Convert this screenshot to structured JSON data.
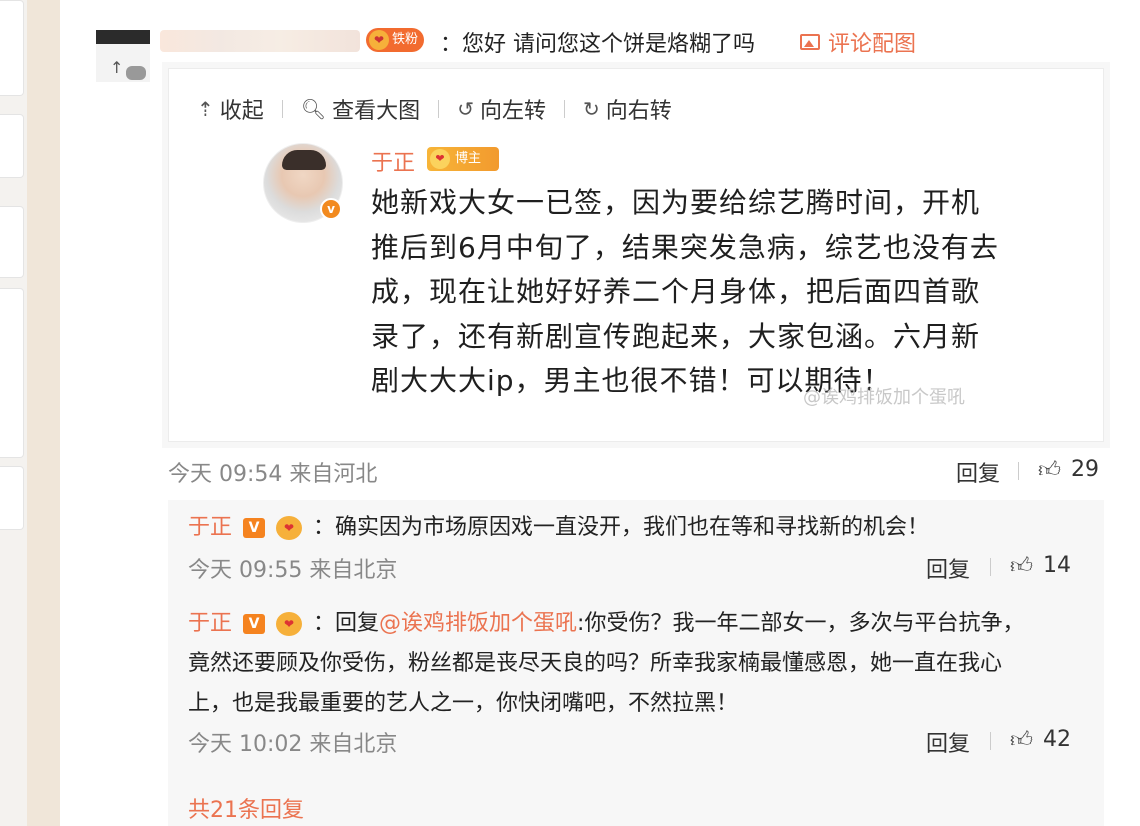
{
  "top_comment": {
    "fan_badge": "铁粉",
    "text": "：您好 请问您这个饼是烙糊了吗",
    "image_link": "评论配图"
  },
  "toolbar": {
    "collapse": "收起",
    "view_large": "查看大图",
    "rotate_left": "向左转",
    "rotate_right": "向右转"
  },
  "post": {
    "author": "于正",
    "badge": "博主",
    "lines": [
      "她新戏大女一已签，因为要给综艺腾时间，开机",
      "推后到6月中旬了，结果突发急病，综艺也没有去",
      "成，现在让她好好养二个月身体，把后面四首歌",
      "录了，还有新剧宣传跑起来，大家包涵。六月新",
      "剧大大大ip，男主也很不错！可以期待！"
    ],
    "watermark": "@诶鸡排饭加个蛋吼"
  },
  "meta": {
    "time": "今天 09:54 来自河北",
    "reply": "回复",
    "likes": "29"
  },
  "replies": [
    {
      "name": "于正",
      "text": "：确实因为市场原因戏一直没开，我们也在等和寻找新的机会！",
      "time": "今天 09:55 来自北京",
      "reply": "回复",
      "likes": "14"
    },
    {
      "name": "于正",
      "prefix": "：回复",
      "mention": "@诶鸡排饭加个蛋吼",
      "line1": ":你受伤？我一年二部女一，多次与平台抗争，",
      "line2": "竟然还要顾及你受伤，粉丝都是丧尽天良的吗？所幸我家楠最懂感恩，她一直在我心",
      "line3": "上，也是我最重要的艺人之一，你快闭嘴吧，不然拉黑！",
      "time": "今天 10:02 来自北京",
      "reply": "回复",
      "likes": "42"
    }
  ],
  "total_replies": "共21条回复",
  "colors": {
    "accent": "#eb7350",
    "badge_orange": "#f5831f",
    "reply_bg": "#f7f7f7"
  }
}
